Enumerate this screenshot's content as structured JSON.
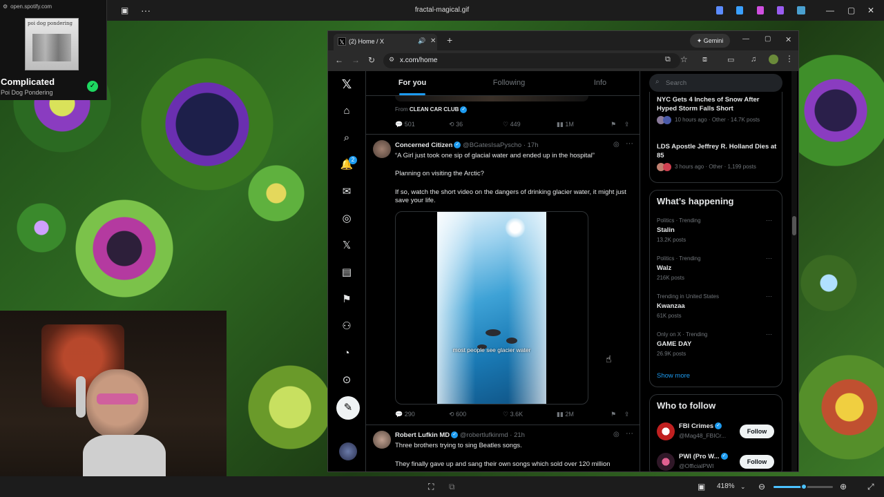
{
  "desktop": {
    "window_title": "fractal-magical.gif"
  },
  "spotify": {
    "url": "open.spotify.com",
    "album_art_text": "poi dog pondering",
    "song_title": "Complicated",
    "artist": "Poi Dog Pondering"
  },
  "browser": {
    "tab_title": "(2) Home / X",
    "gemini_label": "Gemini",
    "url": "x.com/home"
  },
  "nav": {
    "notification_count": "2"
  },
  "feed": {
    "tabs": [
      "For you",
      "Following",
      "Info"
    ],
    "prev_post": {
      "from_label": "From",
      "from_name": "CLEAN CAR CLUB",
      "replies": "501",
      "reposts": "36",
      "likes": "449",
      "views": "1M"
    },
    "post1": {
      "name": "Concerned Citizen",
      "handle": "@BGatesIsaPyscho",
      "time": "· 17h",
      "line1": "“A Girl just took one sip of glacial water and ended up in the hospital”",
      "line2": "Planning on visiting the Arctic?",
      "line3": "If so, watch the short video on the dangers of drinking glacier water, it might just save your life.",
      "video_caption": "most people see glacier water",
      "replies": "290",
      "reposts": "600",
      "likes": "3.6K",
      "views": "2M"
    },
    "post2": {
      "name": "Robert Lufkin MD",
      "handle": "@robertlufkinmd",
      "time": "· 21h",
      "line1": "Three brothers trying to sing Beatles songs.",
      "line2": "They finally gave up and sang their own songs which sold over 120 million"
    }
  },
  "sidebar": {
    "search_placeholder": "Search",
    "news": [
      {
        "title": "NYC Gets 4 Inches of Snow After Hyped Storm Falls Short",
        "meta": "10 hours ago · Other · 14.7K posts"
      },
      {
        "title": "LDS Apostle Jeffrey R. Holland Dies at 85",
        "meta": "3 hours ago · Other · 1,199 posts"
      }
    ],
    "happening_title": "What’s happening",
    "trends": [
      {
        "context": "Politics · Trending",
        "name": "Stalin",
        "posts": "13.2K posts"
      },
      {
        "context": "Politics · Trending",
        "name": "Walz",
        "posts": "216K posts"
      },
      {
        "context": "Trending in United States",
        "name": "Kwanzaa",
        "posts": "61K posts"
      },
      {
        "context": "Only on X · Trending",
        "name": "GAME DAY",
        "posts": "26.9K posts"
      }
    ],
    "show_more": "Show more",
    "who_to_follow_title": "Who to follow",
    "follow": [
      {
        "name": "FBI Crimes",
        "handle": "@Mag48_FBICr...",
        "button": "Follow"
      },
      {
        "name": "PWI (Pro W...",
        "handle": "@OfficialPWI",
        "button": "Follow"
      }
    ]
  },
  "viewer": {
    "zoom": "418%"
  },
  "colors": {
    "accent": "#1d9bf0",
    "spotify_green": "#1ed760"
  }
}
